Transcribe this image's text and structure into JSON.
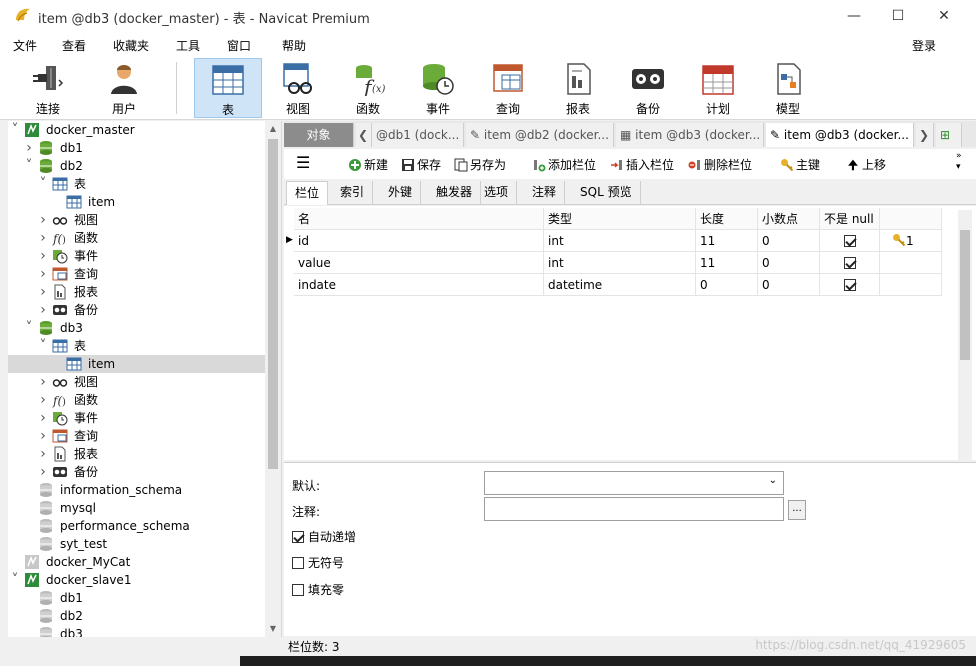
{
  "window": {
    "title": "item @db3 (docker_master) - 表 - Navicat Premium"
  },
  "menu": [
    "文件",
    "查看",
    "收藏夹",
    "工具",
    "窗口",
    "帮助"
  ],
  "login": "登录",
  "toolbar": [
    {
      "label": "连接",
      "icon": "plug-icon"
    },
    {
      "label": "用户",
      "icon": "user-icon"
    },
    {
      "label": "表",
      "icon": "table-icon"
    },
    {
      "label": "视图",
      "icon": "view-icon"
    },
    {
      "label": "函数",
      "icon": "function-icon"
    },
    {
      "label": "事件",
      "icon": "event-icon"
    },
    {
      "label": "查询",
      "icon": "query-icon"
    },
    {
      "label": "报表",
      "icon": "report-icon"
    },
    {
      "label": "备份",
      "icon": "backup-icon"
    },
    {
      "label": "计划",
      "icon": "schedule-icon"
    },
    {
      "label": "模型",
      "icon": "model-icon"
    }
  ],
  "tree": [
    {
      "label": "docker_master",
      "level": 0,
      "arrow": "v",
      "icon": "conn"
    },
    {
      "label": "db1",
      "level": 1,
      "arrow": ">",
      "icon": "db"
    },
    {
      "label": "db2",
      "level": 1,
      "arrow": "v",
      "icon": "db"
    },
    {
      "label": "表",
      "level": 2,
      "arrow": "v",
      "icon": "table"
    },
    {
      "label": "item",
      "level": 3,
      "arrow": "",
      "icon": "table"
    },
    {
      "label": "视图",
      "level": 2,
      "arrow": ">",
      "icon": "view"
    },
    {
      "label": "函数",
      "level": 2,
      "arrow": ">",
      "icon": "func"
    },
    {
      "label": "事件",
      "level": 2,
      "arrow": ">",
      "icon": "event"
    },
    {
      "label": "查询",
      "level": 2,
      "arrow": ">",
      "icon": "query"
    },
    {
      "label": "报表",
      "level": 2,
      "arrow": ">",
      "icon": "report"
    },
    {
      "label": "备份",
      "level": 2,
      "arrow": ">",
      "icon": "backup"
    },
    {
      "label": "db3",
      "level": 1,
      "arrow": "v",
      "icon": "db"
    },
    {
      "label": "表",
      "level": 2,
      "arrow": "v",
      "icon": "table"
    },
    {
      "label": "item",
      "level": 3,
      "arrow": "",
      "icon": "table",
      "selected": true
    },
    {
      "label": "视图",
      "level": 2,
      "arrow": ">",
      "icon": "view"
    },
    {
      "label": "函数",
      "level": 2,
      "arrow": ">",
      "icon": "func"
    },
    {
      "label": "事件",
      "level": 2,
      "arrow": ">",
      "icon": "event"
    },
    {
      "label": "查询",
      "level": 2,
      "arrow": ">",
      "icon": "query"
    },
    {
      "label": "报表",
      "level": 2,
      "arrow": ">",
      "icon": "report"
    },
    {
      "label": "备份",
      "level": 2,
      "arrow": ">",
      "icon": "backup"
    },
    {
      "label": "information_schema",
      "level": 1,
      "arrow": "",
      "icon": "dbgray"
    },
    {
      "label": "mysql",
      "level": 1,
      "arrow": "",
      "icon": "dbgray"
    },
    {
      "label": "performance_schema",
      "level": 1,
      "arrow": "",
      "icon": "dbgray"
    },
    {
      "label": "syt_test",
      "level": 1,
      "arrow": "",
      "icon": "dbgray"
    },
    {
      "label": "docker_MyCat",
      "level": 0,
      "arrow": "",
      "icon": "conngray"
    },
    {
      "label": "docker_slave1",
      "level": 0,
      "arrow": "v",
      "icon": "conn"
    },
    {
      "label": "db1",
      "level": 1,
      "arrow": "",
      "icon": "dbgray"
    },
    {
      "label": "db2",
      "level": 1,
      "arrow": "",
      "icon": "dbgray"
    },
    {
      "label": "db3",
      "level": 1,
      "arrow": "",
      "icon": "dbgray"
    }
  ],
  "tabs": [
    {
      "label": "对象",
      "kind": "obj"
    },
    {
      "label": "@db1 (dock...",
      "kind": "normal"
    },
    {
      "label": "item @db2 (docker...",
      "kind": "normal"
    },
    {
      "label": "item @db3 (docker...",
      "kind": "normal"
    },
    {
      "label": "item @db3 (docker...",
      "kind": "cur"
    }
  ],
  "subtoolbar": {
    "new": "新建",
    "save": "保存",
    "save_as": "另存为",
    "add_field": "添加栏位",
    "insert_field": "插入栏位",
    "delete_field": "删除栏位",
    "primary_key": "主键",
    "move_up": "上移"
  },
  "field_tabs": [
    "栏位",
    "索引",
    "外键",
    "触发器",
    "选项",
    "注释",
    "SQL 预览"
  ],
  "columns": [
    "名",
    "类型",
    "长度",
    "小数点",
    "不是 null",
    ""
  ],
  "rows": [
    {
      "name": "id",
      "type": "int",
      "length": "11",
      "decimals": "0",
      "notnull": true,
      "key": "1"
    },
    {
      "name": "value",
      "type": "int",
      "length": "11",
      "decimals": "0",
      "notnull": true,
      "key": ""
    },
    {
      "name": "indate",
      "type": "datetime",
      "length": "0",
      "decimals": "0",
      "notnull": true,
      "key": ""
    }
  ],
  "props": {
    "default_label": "默认:",
    "comment_label": "注释:",
    "auto_increment": "自动递增",
    "unsigned": "无符号",
    "zerofill": "填充零"
  },
  "status": "栏位数: 3",
  "watermark": "https://blog.csdn.net/qq_41929605"
}
